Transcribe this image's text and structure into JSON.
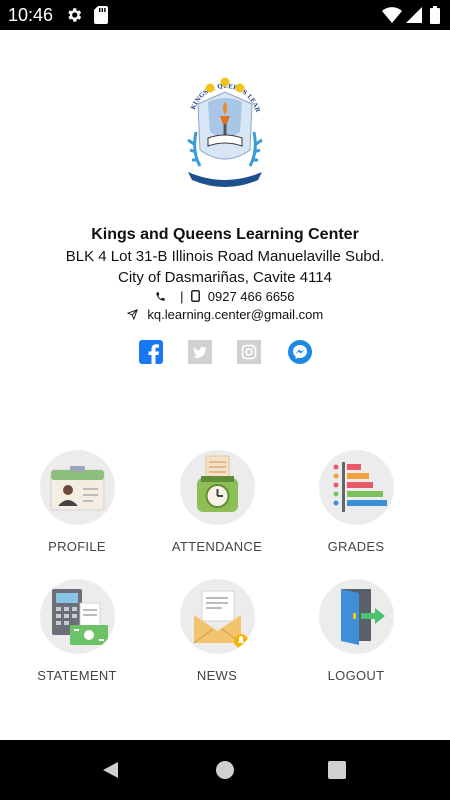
{
  "status_bar": {
    "time": "10:46",
    "left_icons": [
      "gear-icon",
      "sd-card-icon"
    ],
    "right_icons": [
      "wifi-icon",
      "signal-icon",
      "battery-icon"
    ]
  },
  "organization": {
    "logo_text": "KINGS & QUEENS LEARNING CENTER",
    "name": "Kings and Queens Learning Center",
    "address_line1": "BLK 4 Lot 31-B Illinois Road Manuelaville Subd.",
    "address_line2": "City of Dasmariñas, Cavite 4114",
    "phone_separator": "|",
    "phone": "0927 466 6656",
    "email": "kq.learning.center@gmail.com"
  },
  "social_links": [
    "facebook-icon",
    "twitter-icon",
    "instagram-icon",
    "messenger-icon"
  ],
  "colors": {
    "facebook": "#1877f2",
    "social_gray": "#d0d0d0",
    "messenger": "#1e88e5",
    "status_bar": "#000000",
    "nav_bar": "#000000",
    "menu_circle": "#ececec",
    "menu_label": "#444444"
  },
  "menu": [
    {
      "label": "PROFILE",
      "icon": "id-card-icon"
    },
    {
      "label": "ATTENDANCE",
      "icon": "time-clock-icon"
    },
    {
      "label": "GRADES",
      "icon": "bar-chart-icon"
    },
    {
      "label": "STATEMENT",
      "icon": "calculator-money-icon"
    },
    {
      "label": "NEWS",
      "icon": "mail-envelope-icon"
    },
    {
      "label": "LOGOUT",
      "icon": "exit-door-icon"
    }
  ],
  "nav_bar": [
    "back-icon",
    "home-icon",
    "recents-icon"
  ]
}
